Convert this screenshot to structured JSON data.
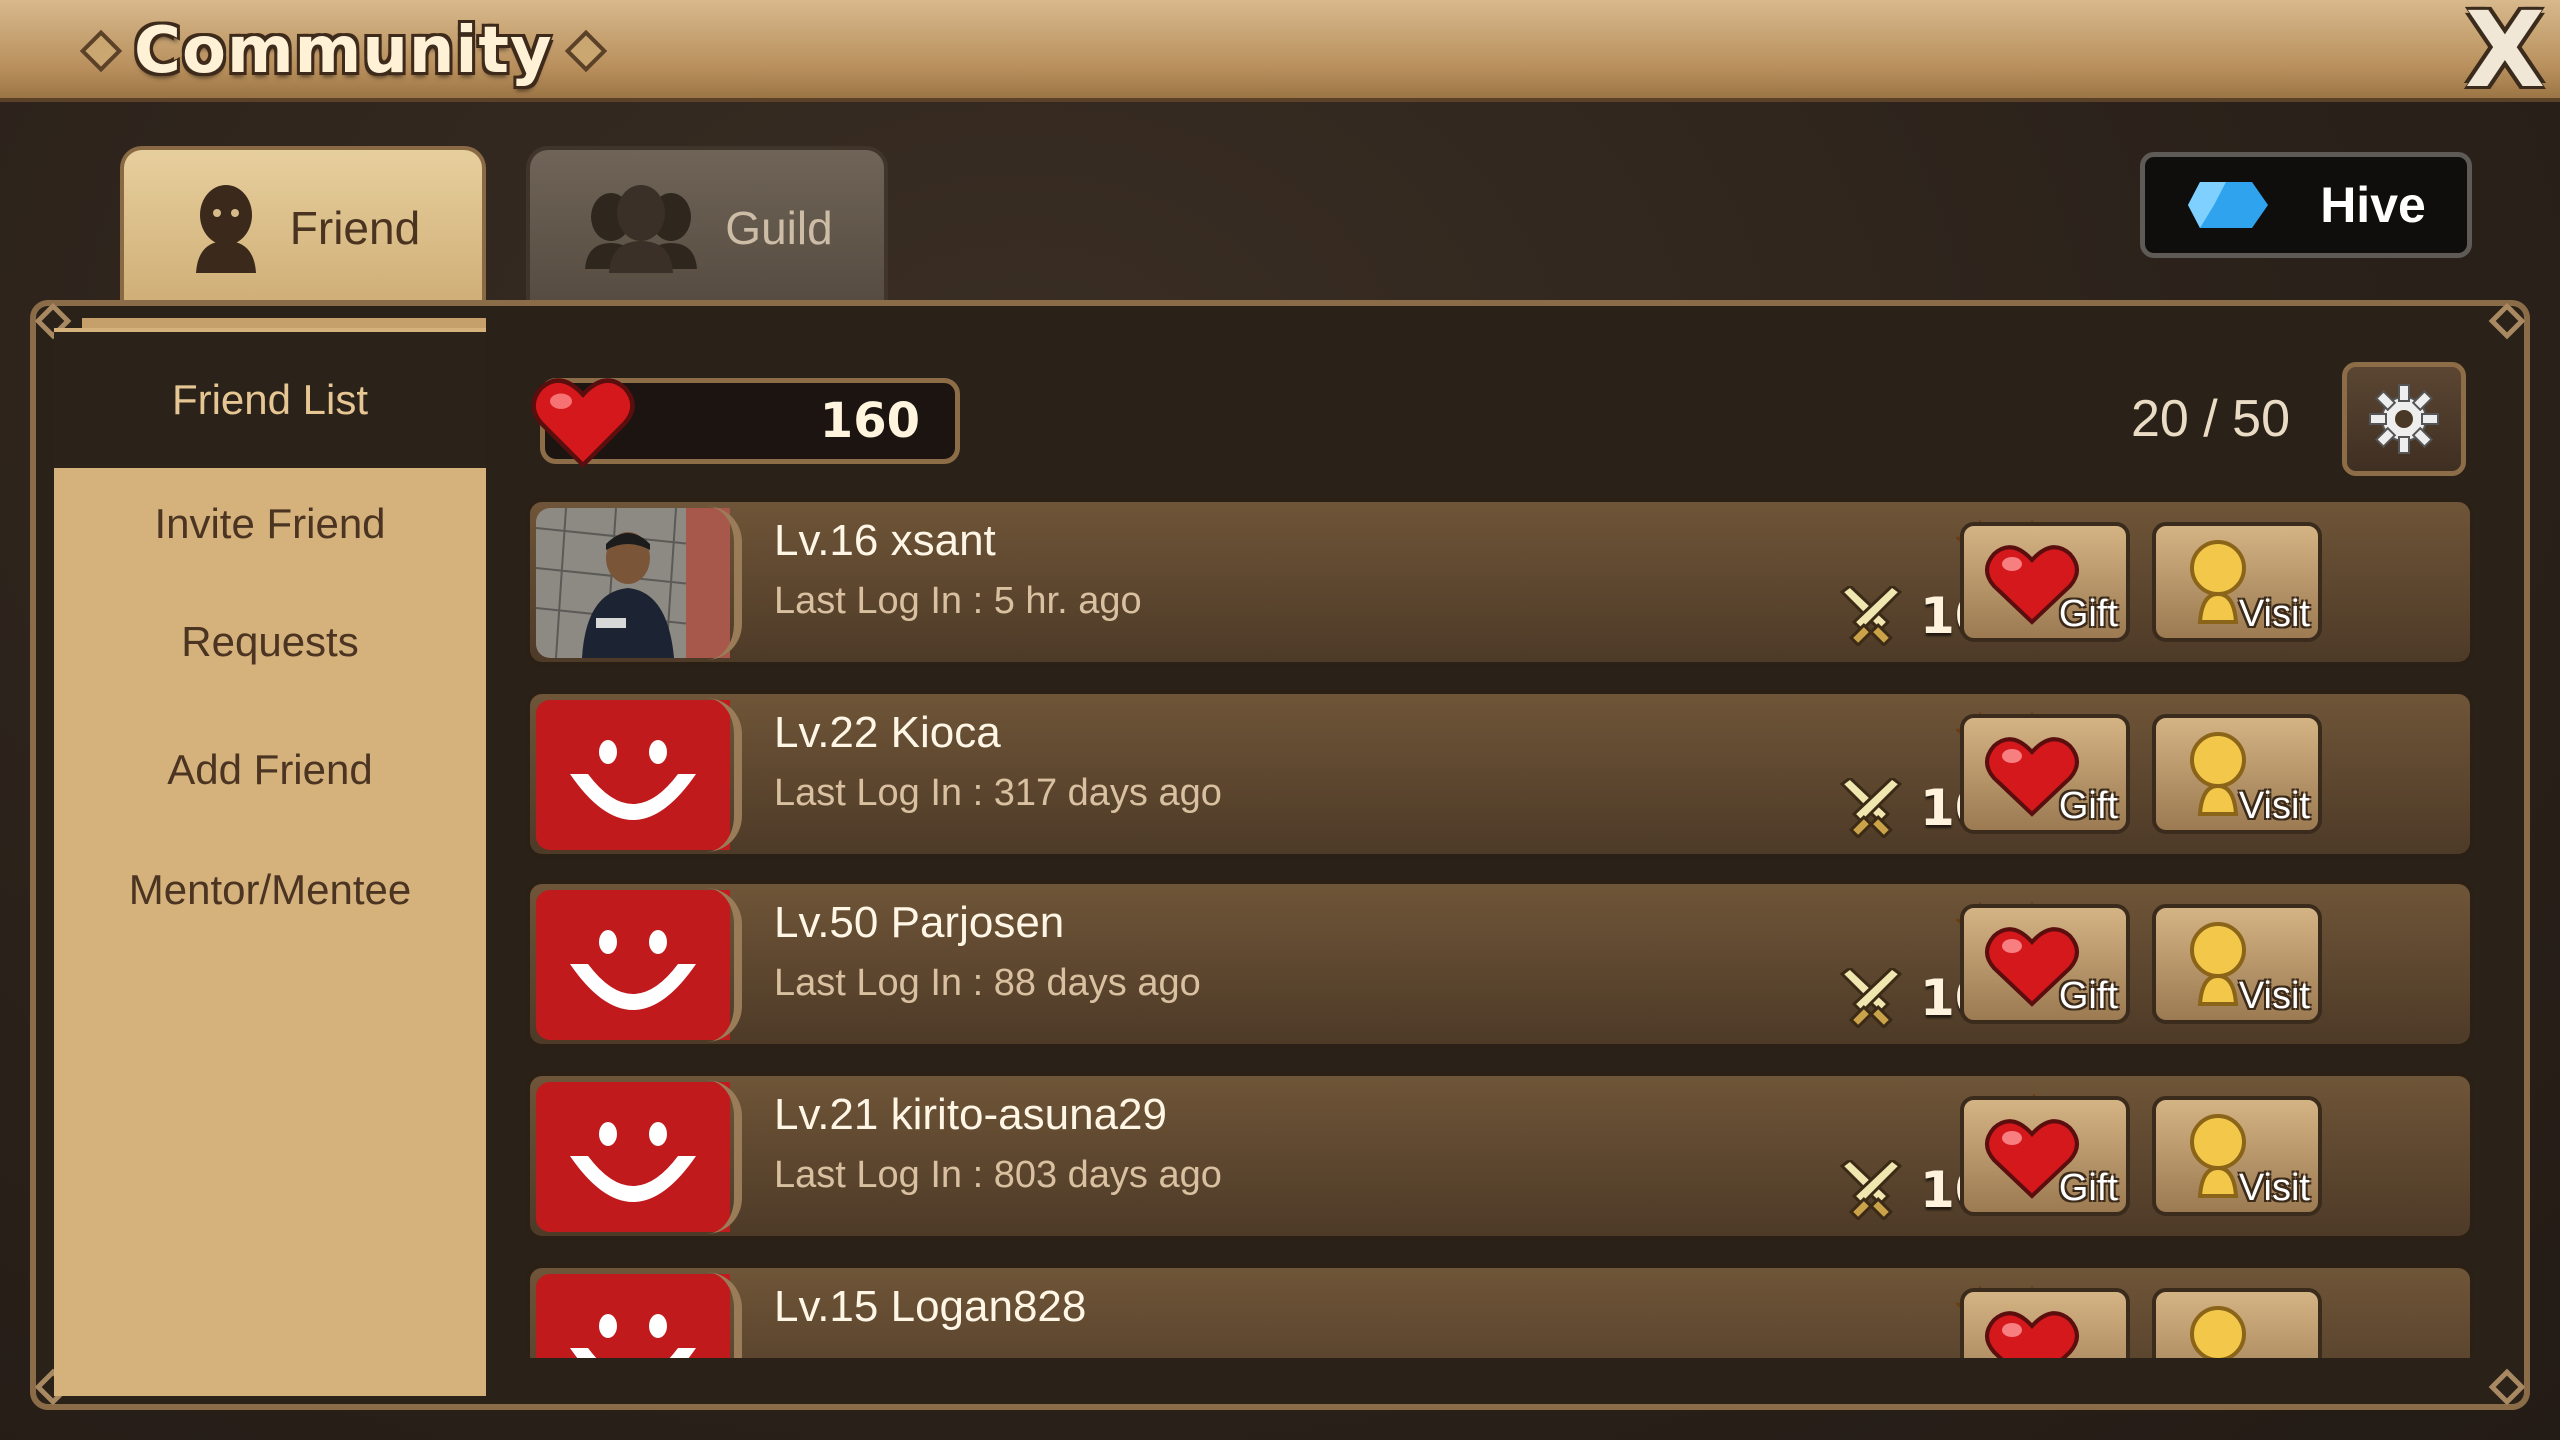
{
  "header": {
    "title": "Community",
    "close_label": "X"
  },
  "tabs": [
    {
      "label": "Friend",
      "icon": "person-icon",
      "active": true
    },
    {
      "label": "Guild",
      "icon": "group-icon",
      "active": false
    }
  ],
  "hive": {
    "label": "Hive"
  },
  "sidebar": {
    "items": [
      {
        "label": "Friend List",
        "active": true
      },
      {
        "label": "Invite Friend"
      },
      {
        "label": "Requests"
      },
      {
        "label": "Add Friend"
      },
      {
        "label": "Mentor/Mentee"
      }
    ]
  },
  "hearts": {
    "count": "160"
  },
  "friend_count": "20 / 50",
  "colors": {
    "accent_red": "#c8161b",
    "panel_brown": "#5c452e",
    "sidebar_tan": "#d5b27c"
  },
  "friends": [
    {
      "level": "Lv.16",
      "name": "xsant",
      "last_login": "Last Log In : 5 hr. ago",
      "stars": 2,
      "pvp": "1001",
      "avatar": "photo"
    },
    {
      "level": "Lv.22",
      "name": "Kioca",
      "last_login": "Last Log In : 317 days ago",
      "stars": 2,
      "pvp": "1000",
      "avatar": "smiley"
    },
    {
      "level": "Lv.50",
      "name": "Parjosen",
      "last_login": "Last Log In : 88 days ago",
      "stars": 2,
      "pvp": "1000",
      "avatar": "smiley"
    },
    {
      "level": "Lv.21",
      "name": "kirito-asuna29",
      "last_login": "Last Log In : 803 days ago",
      "stars": 1,
      "pvp": "1000",
      "avatar": "smiley"
    },
    {
      "level": "Lv.15",
      "name": "Logan828",
      "last_login": "",
      "stars": 2,
      "pvp": "",
      "avatar": "smiley"
    }
  ],
  "buttons": {
    "gift_label": "Gift",
    "visit_label": "Visit"
  }
}
